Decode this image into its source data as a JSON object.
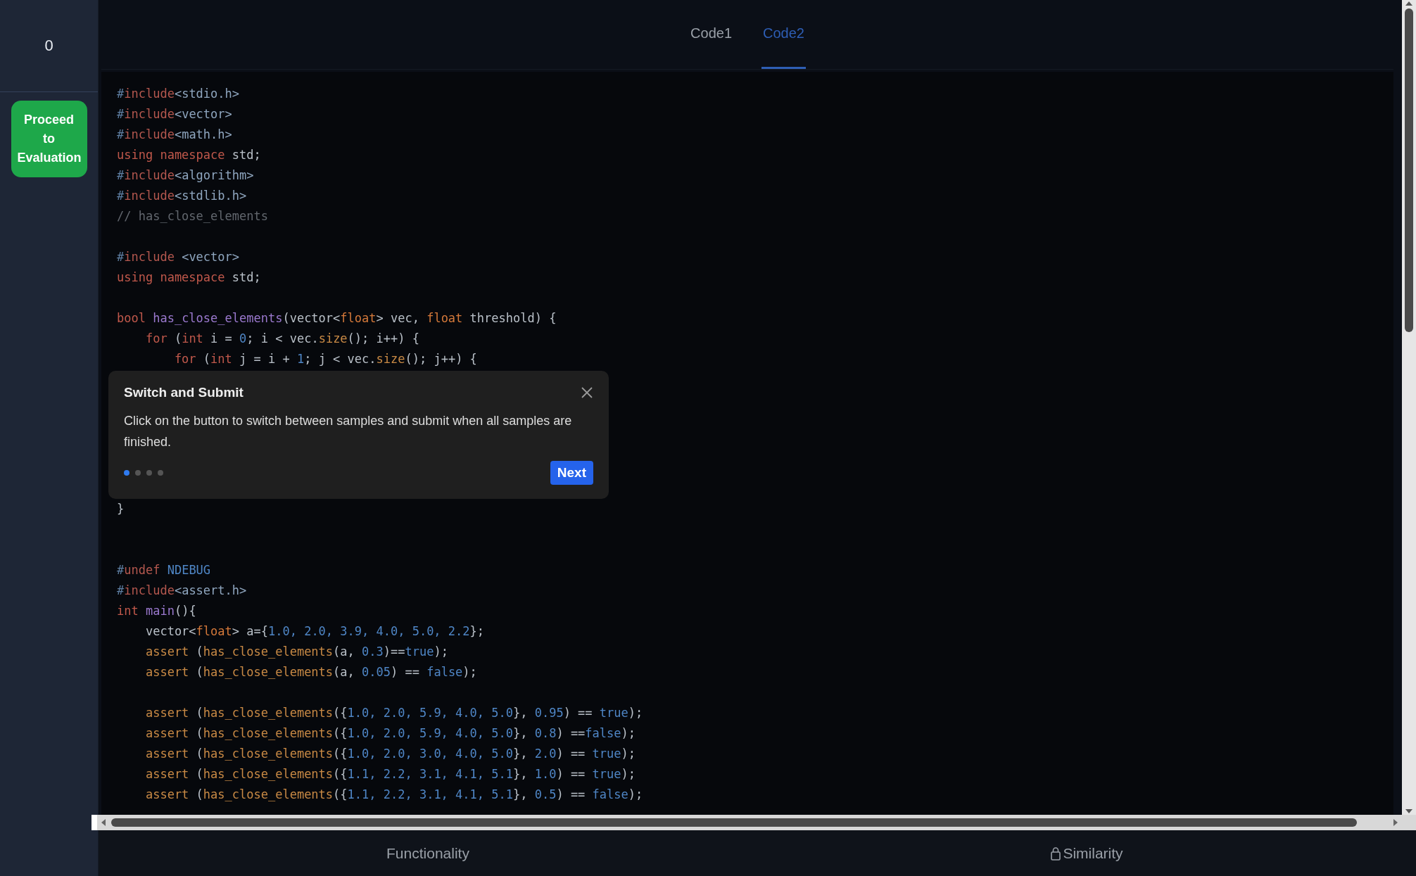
{
  "sidebar": {
    "counter": "0",
    "proceed_button": "Proceed to Evaluation"
  },
  "tabs": [
    {
      "label": "Code1",
      "selected": false
    },
    {
      "label": "Code2",
      "selected": true
    }
  ],
  "code_top": [
    {
      "kind": "line",
      "tokens": [
        {
          "kind": "hash",
          "text": "#"
        },
        {
          "kind": "dir",
          "text": "include"
        },
        {
          "kind": "hdr",
          "text": "<stdio.h>"
        }
      ]
    },
    {
      "kind": "line",
      "tokens": [
        {
          "kind": "hash",
          "text": "#"
        },
        {
          "kind": "dir",
          "text": "include"
        },
        {
          "kind": "hdr",
          "text": "<vector>"
        }
      ]
    },
    {
      "kind": "line",
      "tokens": [
        {
          "kind": "hash",
          "text": "#"
        },
        {
          "kind": "dir",
          "text": "include"
        },
        {
          "kind": "hdr",
          "text": "<math.h>"
        }
      ]
    },
    {
      "kind": "line",
      "tokens": [
        {
          "kind": "kw",
          "text": "using namespace"
        },
        {
          "kind": "plain",
          "text": " std;"
        }
      ]
    },
    {
      "kind": "line",
      "tokens": [
        {
          "kind": "hash",
          "text": "#"
        },
        {
          "kind": "dir",
          "text": "include"
        },
        {
          "kind": "hdr",
          "text": "<algorithm>"
        }
      ]
    },
    {
      "kind": "line",
      "tokens": [
        {
          "kind": "hash",
          "text": "#"
        },
        {
          "kind": "dir",
          "text": "include"
        },
        {
          "kind": "hdr",
          "text": "<stdlib.h>"
        }
      ]
    },
    {
      "kind": "line",
      "tokens": [
        {
          "kind": "comment",
          "text": "// has_close_elements"
        }
      ]
    },
    {
      "kind": "blank"
    },
    {
      "kind": "line",
      "tokens": [
        {
          "kind": "hash",
          "text": "#"
        },
        {
          "kind": "dir",
          "text": "include"
        },
        {
          "kind": "hdr",
          "text": " <vector>"
        }
      ]
    },
    {
      "kind": "line",
      "tokens": [
        {
          "kind": "kw",
          "text": "using namespace"
        },
        {
          "kind": "plain",
          "text": " std;"
        }
      ]
    },
    {
      "kind": "blank"
    },
    {
      "kind": "line",
      "tokens": [
        {
          "kind": "kw",
          "text": "bool"
        },
        {
          "kind": "fn",
          "text": " has_close_elements"
        },
        {
          "kind": "plain",
          "text": "(vector<"
        },
        {
          "kind": "type",
          "text": "float"
        },
        {
          "kind": "plain",
          "text": "> vec, "
        },
        {
          "kind": "type",
          "text": "float"
        },
        {
          "kind": "plain",
          "text": " threshold) {"
        }
      ]
    },
    {
      "kind": "line",
      "tokens": [
        {
          "kind": "kw",
          "text": "    for"
        },
        {
          "kind": "plain",
          "text": " ("
        },
        {
          "kind": "kw",
          "text": "int"
        },
        {
          "kind": "plain",
          "text": " i = "
        },
        {
          "kind": "num",
          "text": "0"
        },
        {
          "kind": "plain",
          "text": "; i < vec."
        },
        {
          "kind": "call",
          "text": "size"
        },
        {
          "kind": "plain",
          "text": "(); i++) {"
        }
      ]
    },
    {
      "kind": "line",
      "tokens": [
        {
          "kind": "kw",
          "text": "        for"
        },
        {
          "kind": "plain",
          "text": " ("
        },
        {
          "kind": "kw",
          "text": "int"
        },
        {
          "kind": "plain",
          "text": " j = i + "
        },
        {
          "kind": "num",
          "text": "1"
        },
        {
          "kind": "plain",
          "text": "; j < vec."
        },
        {
          "kind": "call",
          "text": "size"
        },
        {
          "kind": "plain",
          "text": "(); j++) {"
        }
      ]
    }
  ],
  "popover": {
    "title": "Switch and Submit",
    "body": "Click on the button to switch between samples and submit when all samples are finished.",
    "steps": [
      {
        "selected": true
      },
      {
        "selected": false
      },
      {
        "selected": false
      },
      {
        "selected": false
      }
    ],
    "next_button": "Next"
  },
  "code_bottom": [
    {
      "kind": "line",
      "tokens": [
        {
          "kind": "plain",
          "text": "}"
        }
      ]
    },
    {
      "kind": "blank"
    },
    {
      "kind": "blank"
    },
    {
      "kind": "line",
      "tokens": [
        {
          "kind": "hash",
          "text": "#"
        },
        {
          "kind": "dir",
          "text": "undef"
        },
        {
          "kind": "macro",
          "text": " NDEBUG"
        }
      ]
    },
    {
      "kind": "line",
      "tokens": [
        {
          "kind": "hash",
          "text": "#"
        },
        {
          "kind": "dir",
          "text": "include"
        },
        {
          "kind": "hdr",
          "text": "<assert.h>"
        }
      ]
    },
    {
      "kind": "line",
      "tokens": [
        {
          "kind": "kw",
          "text": "int"
        },
        {
          "kind": "fn",
          "text": " main"
        },
        {
          "kind": "plain",
          "text": "(){"
        }
      ]
    },
    {
      "kind": "line",
      "tokens": [
        {
          "kind": "plain",
          "text": "    vector<"
        },
        {
          "kind": "type",
          "text": "float"
        },
        {
          "kind": "plain",
          "text": "> a={"
        },
        {
          "kind": "num",
          "text": "1.0, 2.0, 3.9, 4.0, 5.0, 2.2"
        },
        {
          "kind": "plain",
          "text": "};"
        }
      ]
    },
    {
      "kind": "line",
      "tokens": [
        {
          "kind": "call",
          "text": "    assert"
        },
        {
          "kind": "plain",
          "text": " ("
        },
        {
          "kind": "call",
          "text": "has_close_elements"
        },
        {
          "kind": "plain",
          "text": "(a, "
        },
        {
          "kind": "num",
          "text": "0.3"
        },
        {
          "kind": "plain",
          "text": ")=="
        },
        {
          "kind": "bool",
          "text": "true"
        },
        {
          "kind": "plain",
          "text": ");"
        }
      ]
    },
    {
      "kind": "line",
      "tokens": [
        {
          "kind": "call",
          "text": "    assert"
        },
        {
          "kind": "plain",
          "text": " ("
        },
        {
          "kind": "call",
          "text": "has_close_elements"
        },
        {
          "kind": "plain",
          "text": "(a, "
        },
        {
          "kind": "num",
          "text": "0.05"
        },
        {
          "kind": "plain",
          "text": ") == "
        },
        {
          "kind": "bool",
          "text": "false"
        },
        {
          "kind": "plain",
          "text": ");"
        }
      ]
    },
    {
      "kind": "blank"
    },
    {
      "kind": "line",
      "tokens": [
        {
          "kind": "call",
          "text": "    assert"
        },
        {
          "kind": "plain",
          "text": " ("
        },
        {
          "kind": "call",
          "text": "has_close_elements"
        },
        {
          "kind": "plain",
          "text": "({"
        },
        {
          "kind": "num",
          "text": "1.0, 2.0, 5.9, 4.0, 5.0"
        },
        {
          "kind": "plain",
          "text": "}, "
        },
        {
          "kind": "num",
          "text": "0.95"
        },
        {
          "kind": "plain",
          "text": ") == "
        },
        {
          "kind": "bool",
          "text": "true"
        },
        {
          "kind": "plain",
          "text": ");"
        }
      ]
    },
    {
      "kind": "line",
      "tokens": [
        {
          "kind": "call",
          "text": "    assert"
        },
        {
          "kind": "plain",
          "text": " ("
        },
        {
          "kind": "call",
          "text": "has_close_elements"
        },
        {
          "kind": "plain",
          "text": "({"
        },
        {
          "kind": "num",
          "text": "1.0, 2.0, 5.9, 4.0, 5.0"
        },
        {
          "kind": "plain",
          "text": "}, "
        },
        {
          "kind": "num",
          "text": "0.8"
        },
        {
          "kind": "plain",
          "text": ") =="
        },
        {
          "kind": "bool",
          "text": "false"
        },
        {
          "kind": "plain",
          "text": ");"
        }
      ]
    },
    {
      "kind": "line",
      "tokens": [
        {
          "kind": "call",
          "text": "    assert"
        },
        {
          "kind": "plain",
          "text": " ("
        },
        {
          "kind": "call",
          "text": "has_close_elements"
        },
        {
          "kind": "plain",
          "text": "({"
        },
        {
          "kind": "num",
          "text": "1.0, 2.0, 3.0, 4.0, 5.0"
        },
        {
          "kind": "plain",
          "text": "}, "
        },
        {
          "kind": "num",
          "text": "2.0"
        },
        {
          "kind": "plain",
          "text": ") == "
        },
        {
          "kind": "bool",
          "text": "true"
        },
        {
          "kind": "plain",
          "text": ");"
        }
      ]
    },
    {
      "kind": "line",
      "tokens": [
        {
          "kind": "call",
          "text": "    assert"
        },
        {
          "kind": "plain",
          "text": " ("
        },
        {
          "kind": "call",
          "text": "has_close_elements"
        },
        {
          "kind": "plain",
          "text": "({"
        },
        {
          "kind": "num",
          "text": "1.1, 2.2, 3.1, 4.1, 5.1"
        },
        {
          "kind": "plain",
          "text": "}, "
        },
        {
          "kind": "num",
          "text": "1.0"
        },
        {
          "kind": "plain",
          "text": ") == "
        },
        {
          "kind": "bool",
          "text": "true"
        },
        {
          "kind": "plain",
          "text": ");"
        }
      ]
    },
    {
      "kind": "line",
      "tokens": [
        {
          "kind": "call",
          "text": "    assert"
        },
        {
          "kind": "plain",
          "text": " ("
        },
        {
          "kind": "call",
          "text": "has_close_elements"
        },
        {
          "kind": "plain",
          "text": "({"
        },
        {
          "kind": "num",
          "text": "1.1, 2.2, 3.1, 4.1, 5.1"
        },
        {
          "kind": "plain",
          "text": "}, "
        },
        {
          "kind": "num",
          "text": "0.5"
        },
        {
          "kind": "plain",
          "text": ") == "
        },
        {
          "kind": "bool",
          "text": "false"
        },
        {
          "kind": "plain",
          "text": ");"
        }
      ]
    }
  ],
  "bottom_tabs": [
    {
      "label": "Functionality",
      "locked": false
    },
    {
      "label": "Similarity",
      "locked": true
    }
  ]
}
